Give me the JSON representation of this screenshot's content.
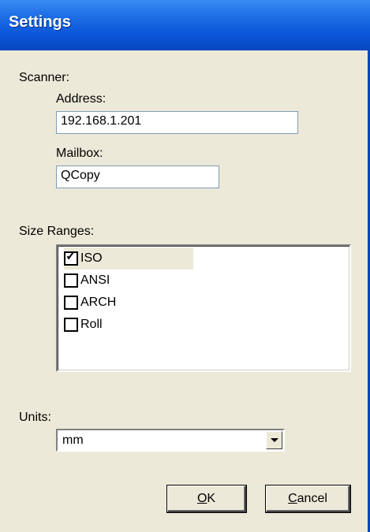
{
  "window": {
    "title": "Settings"
  },
  "scanner": {
    "label": "Scanner:",
    "address_label": "Address:",
    "address_value": "192.168.1.201",
    "mailbox_label": "Mailbox:",
    "mailbox_value": "QCopy"
  },
  "size_ranges": {
    "label": "Size Ranges:",
    "items": [
      {
        "label": "ISO",
        "checked": true,
        "selected": true
      },
      {
        "label": "ANSI",
        "checked": false,
        "selected": false
      },
      {
        "label": "ARCH",
        "checked": false,
        "selected": false
      },
      {
        "label": "Roll",
        "checked": false,
        "selected": false
      }
    ]
  },
  "units": {
    "label": "Units:",
    "selected": "mm"
  },
  "buttons": {
    "ok_mnemonic": "O",
    "ok_rest": "K",
    "cancel_mnemonic": "C",
    "cancel_rest": "ancel"
  },
  "icons": {
    "check": "check-mark-icon",
    "dropdown": "chevron-down-icon"
  }
}
